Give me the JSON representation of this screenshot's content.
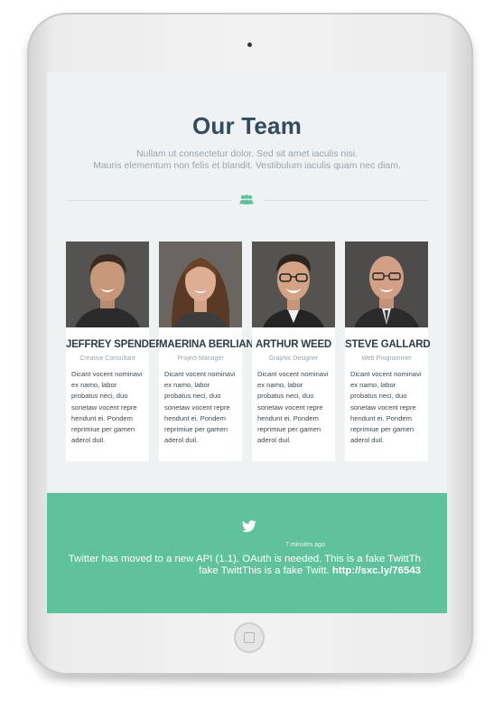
{
  "section": {
    "title": "Our Team",
    "subtitle_line1": "Nullam ut consectetur dolor. Sed sit amet iaculis nisi.",
    "subtitle_line2": "Mauris elementum non felis et blandit. Vestibulum iaculis quam nec diam.",
    "divider_icon": "group-icon"
  },
  "team": [
    {
      "name": "JEFFREY SPENDER",
      "role": "Creative Consultant",
      "bio": "Dicant vocent nominavi ex namo, labor probatus neci, duo sonetaw vocent repre hendunt ei. Pondem reprimiue per gamen aderol duil."
    },
    {
      "name": "MAERINA BERLIANA",
      "role": "Project Manager",
      "bio": "Dicant vocent nominavi ex namo, labor probatus neci, duo sonetaw vocent repre hendunt ei. Pondem reprimiue per gamen aderol duil."
    },
    {
      "name": "ARTHUR WEED",
      "role": "Graphic Designer",
      "bio": "Dicant vocent nominavi ex namo, labor probatus neci, duo sonetaw vocent repre hendunt ei. Pondem reprimiue per gamen aderol duil."
    },
    {
      "name": "STEVE GALLARD",
      "role": "Web Programmer",
      "bio": "Dicant vocent nominavi ex namo, labor probatus neci, duo sonetaw vocent repre hendunt ei. Pondem reprimiue per gamen aderol duil."
    }
  ],
  "twitter": {
    "icon": "twitter-bird-icon",
    "time": "7 minutes ago",
    "text_line1": "Twitter has moved to a new API (1.1). OAuth is needed. This is a fake TwittTh",
    "text_line2": "fake TwittThis is a fake Twitt.",
    "link": "http://sxc.ly/76543"
  },
  "colors": {
    "title": "#324b5e",
    "accent_green": "#5fc29c",
    "screen_bg": "#eef2f3"
  }
}
